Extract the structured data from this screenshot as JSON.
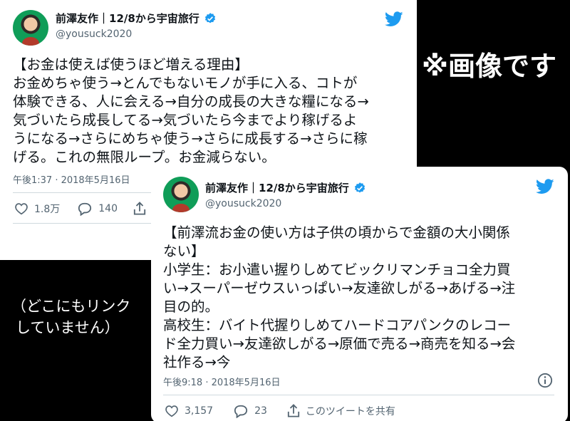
{
  "tweet1": {
    "display_name": "前澤友作｜12/8から宇宙旅行",
    "handle": "@yousuck2020",
    "text_lines": [
      "【お金は使えば使うほど増える理由】",
      "お金めちゃ使う→とんでもないモノが手に入る、コトが",
      "体験できる、人に会える→自分の成長の大きな糧になる→",
      "気づいたら成長してる→気づいたら今までより稼げるよ",
      "うになる→さらにめちゃ使う→さらに成長する→さらに稼",
      "げる。これの無限ループ。お金減らない。"
    ],
    "timestamp": "午後1:37 · 2018年5月16日",
    "likes": "1.8万",
    "replies": "140"
  },
  "tweet2": {
    "display_name": "前澤友作｜12/8から宇宙旅行",
    "handle": "@yousuck2020",
    "text_lines": [
      "【前澤流お金の使い方は子供の頃からで金額の大小関係",
      "ない】",
      "小学生：お小遣い握りしめてビックリマンチョコ全力買",
      "い→スーパーゼウスいっぱい→友達欲しがる→あげる→注",
      "目の的。",
      "高校生：バイト代握りしめてハードコアパンクのレコー",
      "ド全力買い→友達欲しがる→原価で売る→商売を知る→会",
      "社作る→今"
    ],
    "timestamp": "午後9:18 · 2018年5月16日",
    "likes": "3,157",
    "replies": "23",
    "share_label": "このツイートを共有"
  },
  "overlay": {
    "note": "※画像です",
    "no_link_lines": [
      "（どこにもリンク",
      "していません）"
    ]
  },
  "colors": {
    "twitter_blue": "#1d9bf0",
    "verified_blue": "#1d9bf0",
    "background": "#000000",
    "card": "#ffffff",
    "secondary_text": "#536471"
  }
}
